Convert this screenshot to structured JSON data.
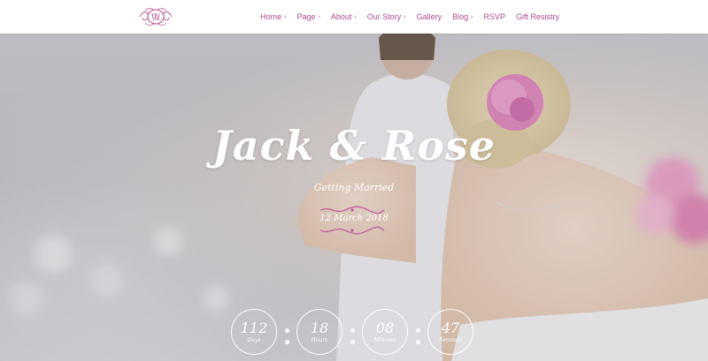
{
  "nav": {
    "items": [
      {
        "label": "Home",
        "has_dropdown": true
      },
      {
        "label": "Page",
        "has_dropdown": true
      },
      {
        "label": "About",
        "has_dropdown": true
      },
      {
        "label": "Our Story",
        "has_dropdown": true
      },
      {
        "label": "Gallery",
        "has_dropdown": false
      },
      {
        "label": "Blog",
        "has_dropdown": true
      },
      {
        "label": "RSVP",
        "has_dropdown": false
      },
      {
        "label": "Gift Resistry",
        "has_dropdown": false
      }
    ],
    "chevron": "›"
  },
  "hero": {
    "title": "Jack & Rose",
    "subtitle": "Getting Married",
    "date": "12 March 2018"
  },
  "countdown": [
    {
      "value": "112",
      "label": "Days"
    },
    {
      "value": "18",
      "label": "Hours"
    },
    {
      "value": "08",
      "label": "Minutes"
    },
    {
      "value": "47",
      "label": "Seconds"
    }
  ],
  "colors": {
    "accent": "#b3488f",
    "divider": "#c2559e"
  },
  "icons": {
    "logo": "monogram-logo-icon",
    "dropdown": "chevron-right-icon"
  }
}
